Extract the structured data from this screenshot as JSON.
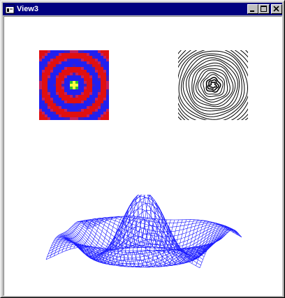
{
  "window": {
    "title": "View3"
  },
  "colors": {
    "titlebar": "#000080",
    "mesh": "#1a1aff",
    "contour": "#000000",
    "ring_blue": "#2020f0",
    "ring_red": "#e01010",
    "center": "#ffff40"
  },
  "icons": {
    "system": "window-doc-icon",
    "minimize": "minimize-icon",
    "maximize": "maximize-icon",
    "close": "close-icon"
  }
}
